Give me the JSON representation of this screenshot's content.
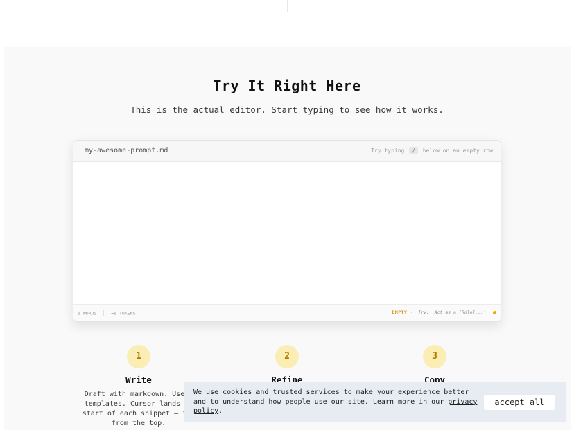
{
  "section": {
    "title": "Try It Right Here",
    "subtitle": "This is the actual editor. Start typing to see how it works."
  },
  "editor": {
    "filename": "my-awesome-prompt.md",
    "hint_prefix": "Try typing",
    "hint_key": "/",
    "hint_suffix": "below on an empty row",
    "content": "",
    "footer": {
      "words_count": "0",
      "words_label": "WORDS",
      "tokens_count": "~0",
      "tokens_label": "TOKENS",
      "status": "EMPTY",
      "separator": "·",
      "try_hint": "Try: 'Act as a [Role]...'"
    }
  },
  "steps": [
    {
      "number": "1",
      "title": "Write",
      "description": "Draft with markdown. Use / templates. Cursor lands at start of each snippet — fil from the top."
    },
    {
      "number": "2",
      "title": "Refine",
      "description": ""
    },
    {
      "number": "3",
      "title": "Copy",
      "description": ""
    }
  ],
  "cookie": {
    "text": "We use cookies and trusted services to make your experience better and to understand how people use our site. Learn more in our ",
    "link": "privacy policy",
    "after": ".",
    "button": "accept all"
  },
  "colors": {
    "accent": "#d4900c",
    "step_circle": "#fbeeb4",
    "banner": "#e7ebf2"
  }
}
